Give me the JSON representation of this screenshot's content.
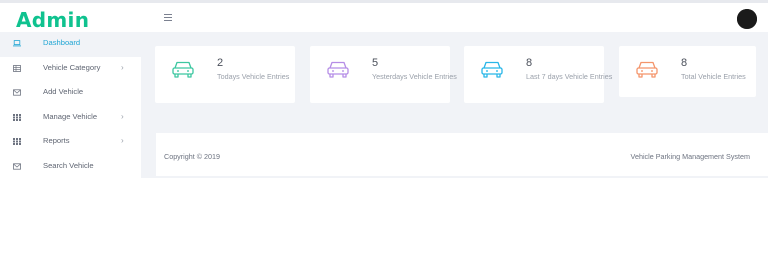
{
  "header": {
    "logo": "Admin"
  },
  "sidebar": {
    "items": [
      {
        "label": "Dashboard",
        "icon": "laptop-icon",
        "active": true,
        "has_chevron": false
      },
      {
        "label": "Vehicle Category",
        "icon": "table-icon",
        "active": false,
        "has_chevron": true
      },
      {
        "label": "Add Vehicle",
        "icon": "envelope-icon",
        "active": false,
        "has_chevron": false
      },
      {
        "label": "Manage Vehicle",
        "icon": "grid-icon",
        "active": false,
        "has_chevron": true
      },
      {
        "label": "Reports",
        "icon": "grid-icon",
        "active": false,
        "has_chevron": true
      },
      {
        "label": "Search Vehicle",
        "icon": "envelope-icon",
        "active": false,
        "has_chevron": false
      }
    ]
  },
  "cards": [
    {
      "value": "2",
      "label": "Todays Vehicle Entries",
      "color": "#3cc7a0"
    },
    {
      "value": "5",
      "label": "Yesterdays Vehicle Entries",
      "color": "#b58de6"
    },
    {
      "value": "8",
      "label": "Last 7 days Vehicle Entries",
      "color": "#28b6e8"
    },
    {
      "value": "8",
      "label": "Total Vehicle Entries",
      "color": "#f4956b"
    }
  ],
  "footer": {
    "copyright": "Copyright © 2019",
    "system": "Vehicle Parking Management System"
  },
  "colors": {
    "accent": "#21a6d4",
    "logo": "#0fc28f",
    "background": "#f1f3f7"
  }
}
